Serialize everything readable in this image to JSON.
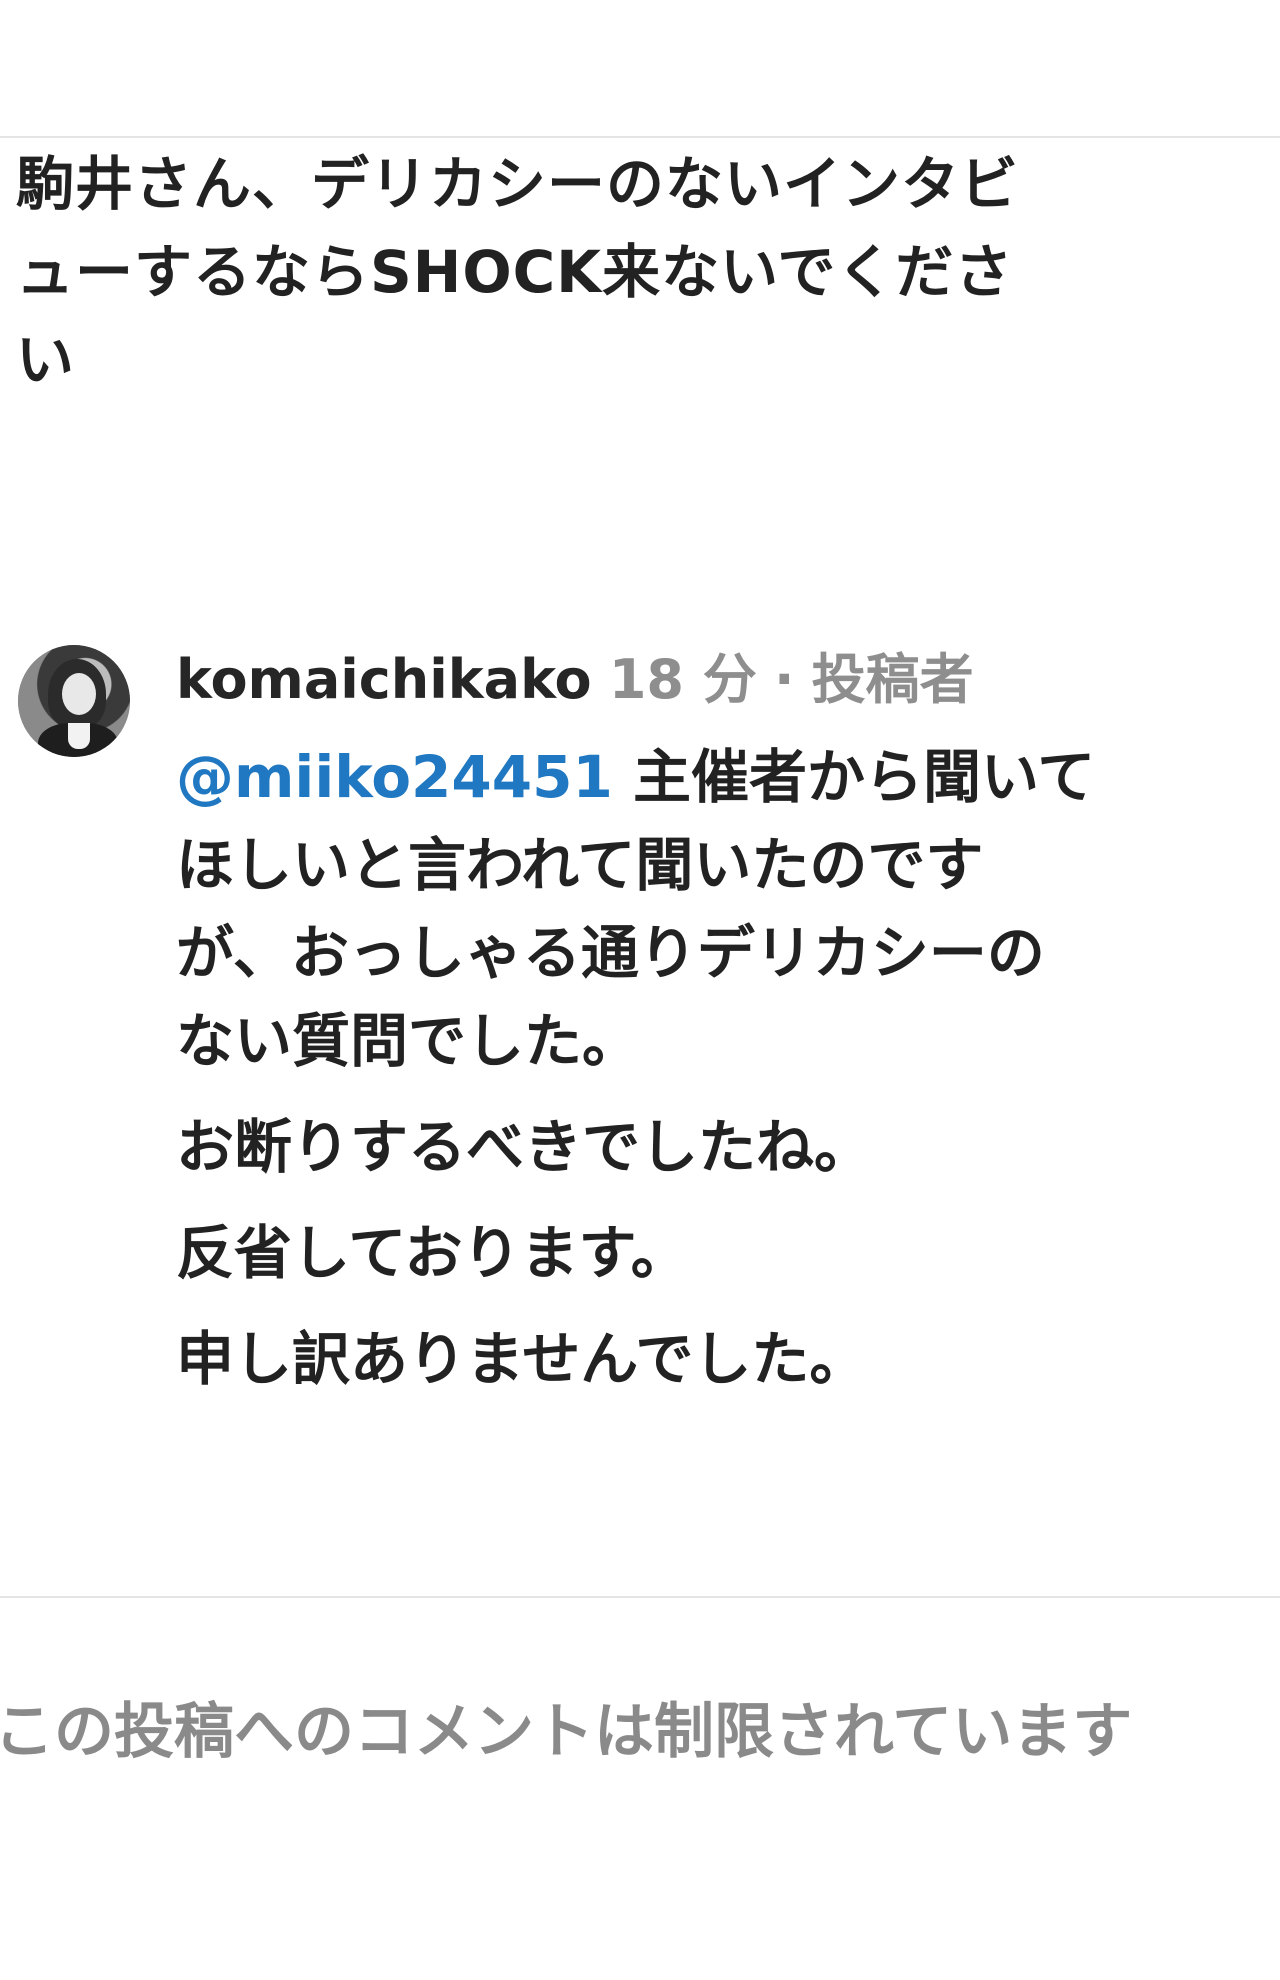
{
  "parent_comment": {
    "lines": [
      "駒井さん、デリカシーのないインタビ",
      "ューするならSHOCK来ないでくださ",
      "い"
    ]
  },
  "reply": {
    "username": "komaichikako",
    "time": "18 分",
    "separator": "·",
    "role": "投稿者",
    "mention": "@miiko24451",
    "first_line_rest": " 主催者から聞いて",
    "lines": [
      "ほしいと言われて聞いたのです",
      "が、おっしゃる通りデリカシーの",
      "ない質問でした。",
      "お断りするべきでしたね。",
      "反省しております。",
      "申し訳ありませんでした。"
    ]
  },
  "footer": {
    "restricted_notice": "この投稿へのコメントは制限されています"
  }
}
